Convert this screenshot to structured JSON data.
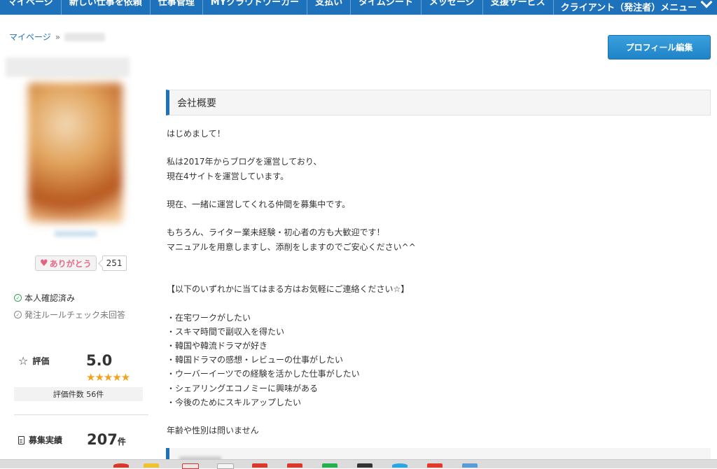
{
  "nav": {
    "items": [
      "マイページ",
      "新しい仕事を依頼",
      "仕事管理",
      "MYクラウドワーカー",
      "支払い",
      "タイムシート",
      "メッセージ",
      "支援サービス"
    ],
    "right_menu": "クライアント（発注者）メニュー"
  },
  "breadcrumb": {
    "home": "マイページ",
    "separator": "»"
  },
  "profile_edit_button": "プロフィール編集",
  "thanks": {
    "label": "ありがとう",
    "count": "251"
  },
  "verification": {
    "identity": "本人確認済み",
    "order_rule": "発注ルールチェック未回答"
  },
  "rating": {
    "label": "評価",
    "value": "5.0",
    "stars": "★★★★★",
    "count_text": "評価件数 56件"
  },
  "recruitment": {
    "label": "募集実績",
    "value": "207",
    "unit": "件"
  },
  "company_overview": {
    "title": "会社概要",
    "body": "はじめまして！\n\n私は2017年からブログを運営しており、\n現在4サイトを運営しています。\n\n現在、一緒に運営してくれる仲間を募集中です。\n\nもちろん、ライター業未経験・初心者の方も大歓迎です！\nマニュアルを用意しますし、添削をしますのでご安心ください^^\n\n\n【以下のいずれかに当てはまる方はお気軽にご連絡ください☆】\n\n・在宅ワークがしたい\n・スキマ時間で副収入を得たい\n・韓国や韓流ドラマが好き\n・韓国ドラマの感想・レビューの仕事がしたい\n・ウーバーイーツでの経験を活かした仕事がしたい\n・シェアリングエコノミーに興味がある\n・今後のためにスキルアップしたい\n\n年齢や性別は問いません"
  },
  "colors": {
    "nav_bg": "#1e72bc",
    "accent": "#1e72bc",
    "star": "#f3a21c",
    "button": "#2b90d6"
  }
}
